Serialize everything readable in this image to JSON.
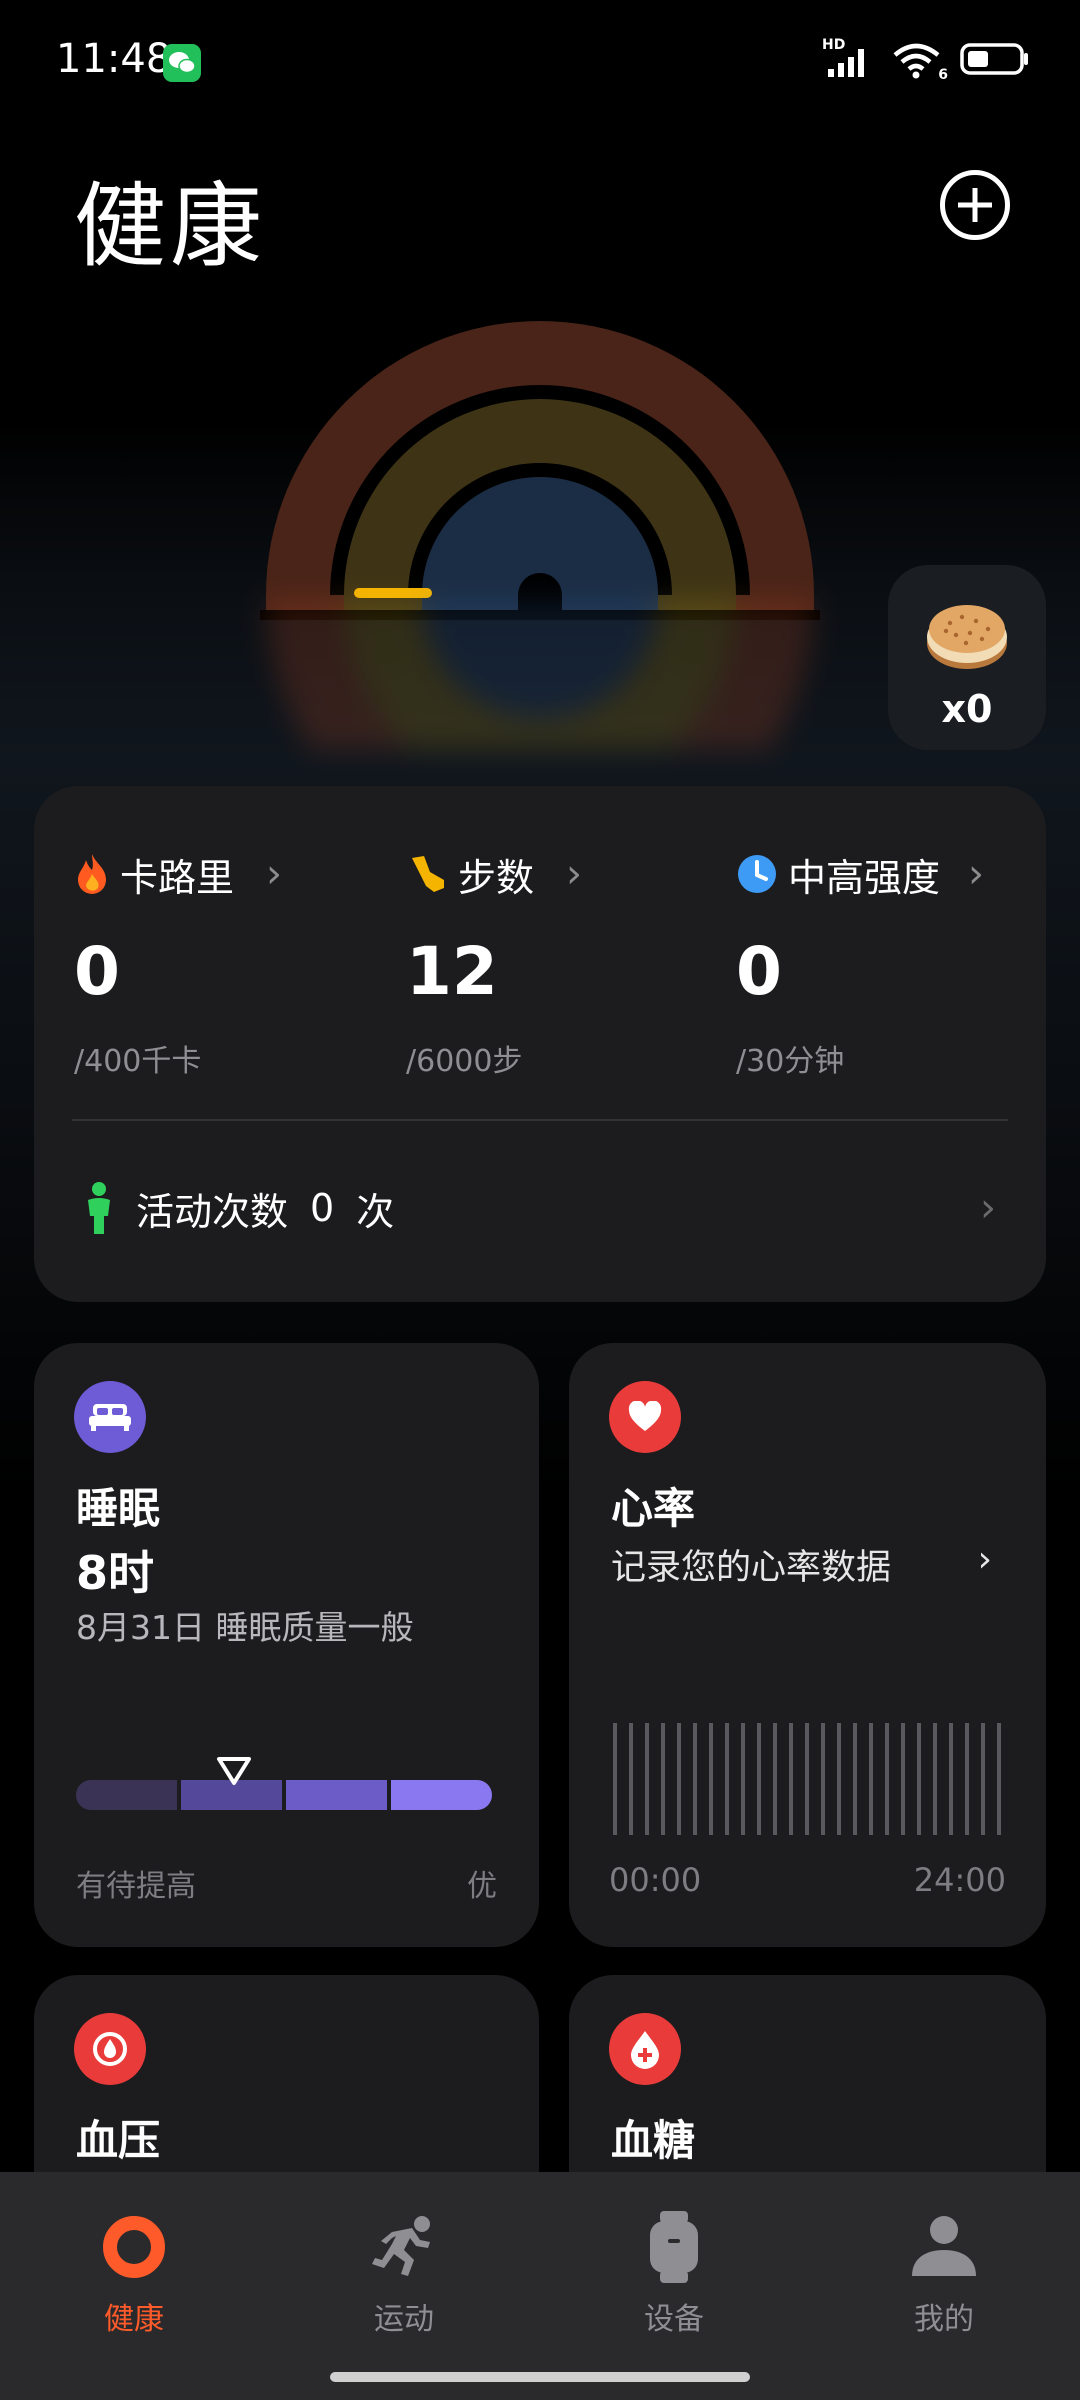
{
  "status_bar": {
    "time": "11:48",
    "network": "HD",
    "wifi_label": "6"
  },
  "header": {
    "title": "健康"
  },
  "rewards": {
    "cookie_count": "x0"
  },
  "stats": {
    "calories": {
      "label": "卡路里",
      "value": "0",
      "goal": "/400千卡"
    },
    "steps": {
      "label": "步数",
      "value": "12",
      "goal": "/6000步"
    },
    "intensity": {
      "label": "中高强度",
      "value": "0",
      "goal": "/30分钟"
    },
    "activity": {
      "label": "活动次数",
      "count": "0",
      "unit": "次"
    }
  },
  "sleep": {
    "title": "睡眠",
    "hours": "8时",
    "summary": "8月31日 睡眠质量一般",
    "scale_low": "有待提高",
    "scale_high": "优",
    "quality_fraction": 0.38
  },
  "heart_rate": {
    "title": "心率",
    "subtitle": "记录您的心率数据",
    "start_time": "00:00",
    "end_time": "24:00"
  },
  "blood_pressure": {
    "title": "血压"
  },
  "blood_sugar": {
    "title": "血糖"
  },
  "nav": {
    "items": [
      {
        "label": "健康",
        "icon": "ring-icon",
        "active": true
      },
      {
        "label": "运动",
        "icon": "running-icon",
        "active": false
      },
      {
        "label": "设备",
        "icon": "watch-icon",
        "active": false
      },
      {
        "label": "我的",
        "icon": "person-icon",
        "active": false
      }
    ]
  },
  "colors": {
    "accent": "#ff5a2a",
    "calorie_ring": "#4a2418",
    "steps_ring": "#3e3415",
    "intensity_ring": "#1b2d44",
    "steps_progress": "#f5b400",
    "sleep_icon_bg": "#6e5bd6",
    "heart_icon_bg": "#ea3b3b"
  }
}
